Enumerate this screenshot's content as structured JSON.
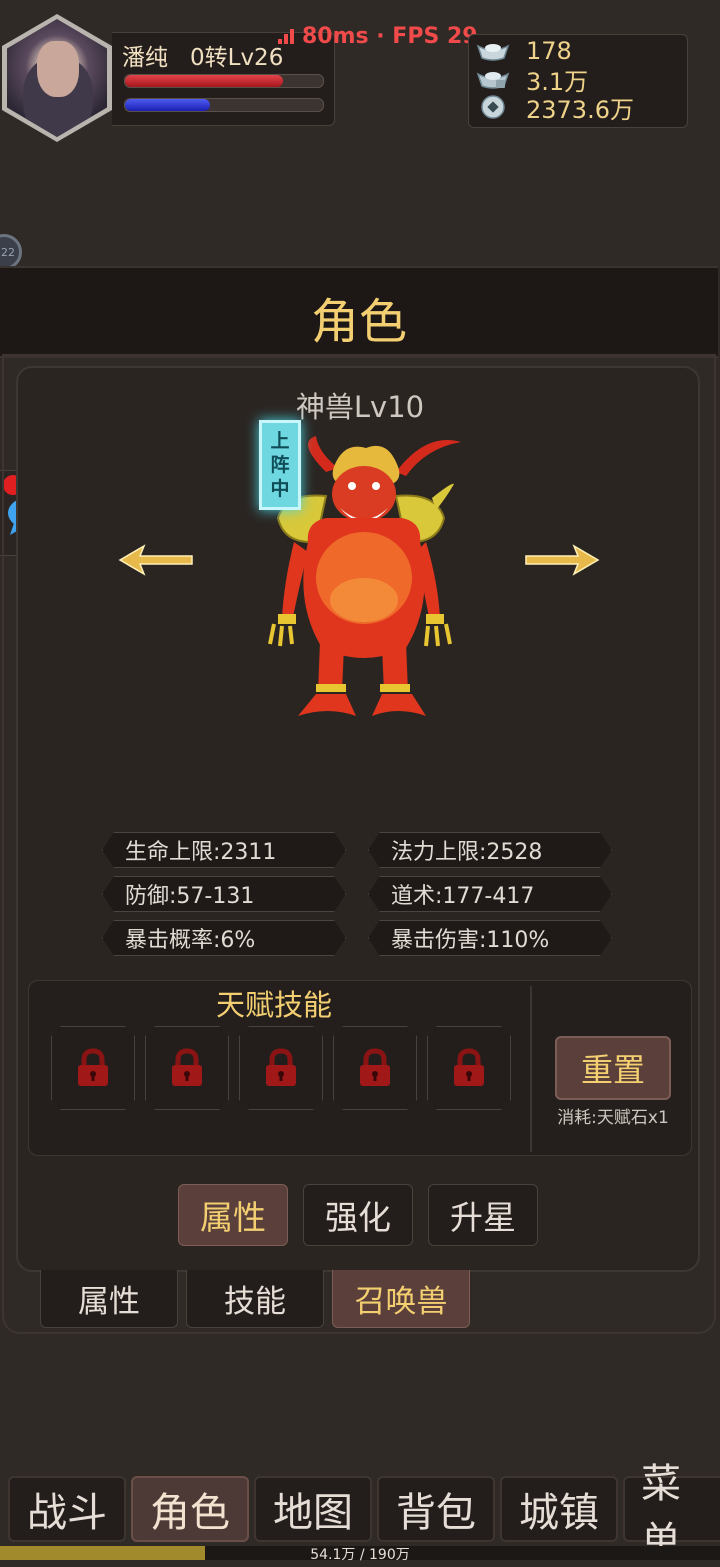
{
  "player": {
    "name": "潘纯",
    "level": "0转Lv26",
    "hp_fraction": 0.8,
    "mp_fraction": 0.43
  },
  "perf": {
    "text": "80ms · FPS 29"
  },
  "currency": {
    "gold_ingot": "178",
    "bound_ingot": "3.1万",
    "coins": "2373.6万"
  },
  "page": {
    "title": "角色"
  },
  "pet": {
    "level_label": "神兽Lv10",
    "deploy_tag": [
      "上",
      "阵",
      "中"
    ]
  },
  "stats": {
    "hp_max": "生命上限:2311",
    "mp_max": "法力上限:2528",
    "defense": "防御:57-131",
    "taoism": "道术:177-417",
    "crit_rate": "暴击概率:6%",
    "crit_damage": "暴击伤害:110%"
  },
  "talent": {
    "title": "天赋技能",
    "reset_label": "重置",
    "reset_cost": "消耗:天赋石x1"
  },
  "sub_tabs": [
    "属性",
    "强化",
    "升星"
  ],
  "main_tabs": [
    "属性",
    "技能",
    "召唤兽"
  ],
  "nav": [
    "战斗",
    "角色",
    "地图",
    "背包",
    "城镇",
    "菜单"
  ],
  "xp": {
    "text": "54.1万 / 190万",
    "fraction": 0.285
  },
  "colors": {
    "gold": "#f3cf72",
    "accent_tab": "#5a3f3a",
    "background": "#302a27"
  }
}
